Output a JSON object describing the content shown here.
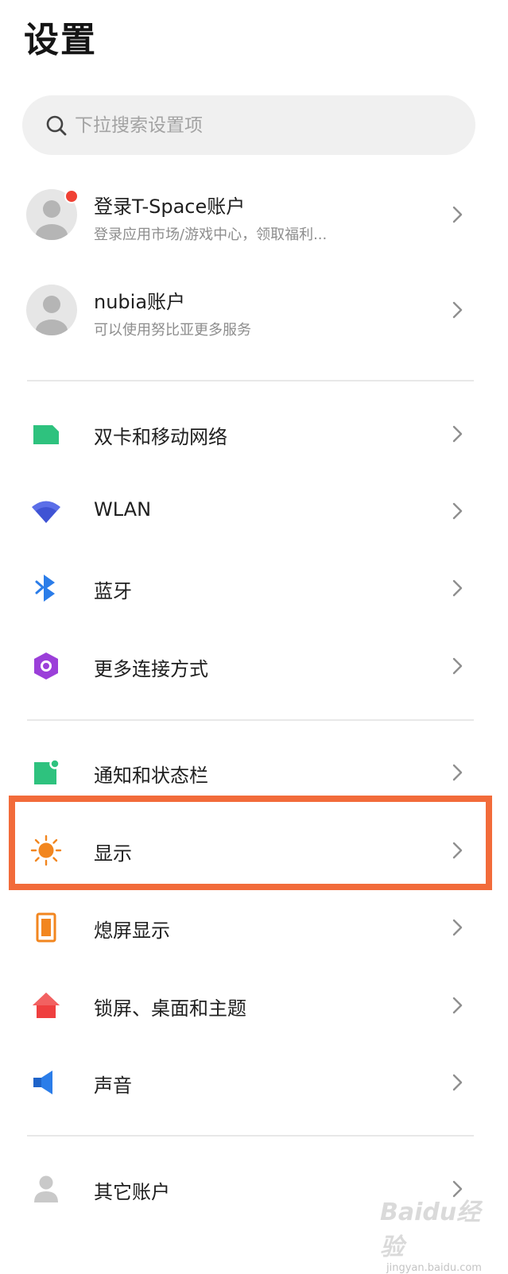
{
  "header": {
    "title": "设置"
  },
  "search": {
    "placeholder": "下拉搜索设置项"
  },
  "accounts": [
    {
      "title": "登录T-Space账户",
      "subtitle": "登录应用市场/游戏中心，领取福利...",
      "has_badge": true
    },
    {
      "title": "nubia账户",
      "subtitle": "可以使用努比亚更多服务",
      "has_badge": false
    }
  ],
  "group1": [
    {
      "label": "双卡和移动网络",
      "icon": "sim-card-icon",
      "color": "#2ec27e"
    },
    {
      "label": "WLAN",
      "icon": "wifi-icon",
      "color": "#5b6ee8"
    },
    {
      "label": "蓝牙",
      "icon": "bluetooth-icon",
      "color": "#2b7de9"
    },
    {
      "label": "更多连接方式",
      "icon": "hexagon-link-icon",
      "color": "#9b3fd9"
    }
  ],
  "group2": [
    {
      "label": "通知和状态栏",
      "icon": "notification-icon",
      "color": "#2ec27e"
    },
    {
      "label": "显示",
      "icon": "sun-icon",
      "color": "#f2861f",
      "highlighted": true
    },
    {
      "label": "熄屏显示",
      "icon": "phone-screen-icon",
      "color": "#f2861f"
    },
    {
      "label": "锁屏、桌面和主题",
      "icon": "home-icon",
      "color": "#ef3f3f"
    },
    {
      "label": "声音",
      "icon": "speaker-icon",
      "color": "#2b7de9"
    }
  ],
  "group3": [
    {
      "label": "其它账户",
      "icon": "person-icon",
      "color": "#c9c9c9"
    }
  ],
  "highlight_color": "#f26b3a",
  "watermark": {
    "main": "Baidu经验",
    "sub": "jingyan.baidu.com"
  }
}
